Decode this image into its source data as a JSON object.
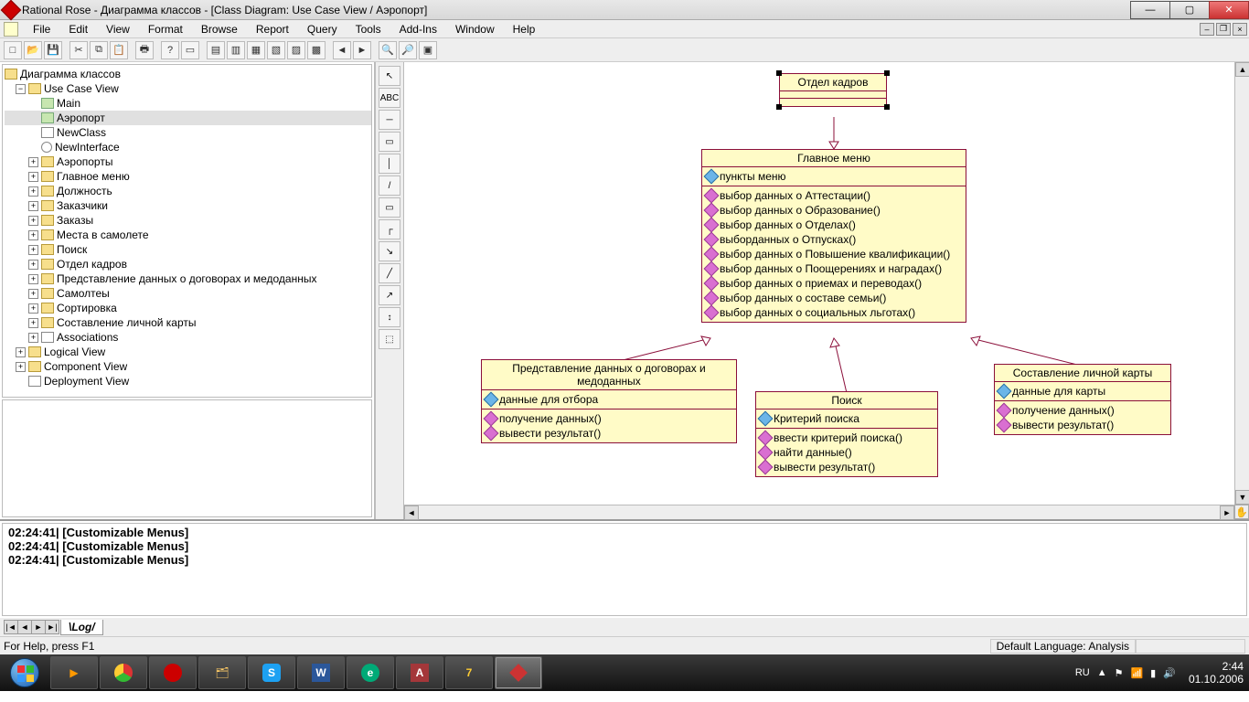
{
  "window": {
    "title": "Rational Rose - Диаграмма классов - [Class Diagram: Use Case View / Аэропорт]"
  },
  "menu": [
    "File",
    "Edit",
    "View",
    "Format",
    "Browse",
    "Report",
    "Query",
    "Tools",
    "Add-Ins",
    "Window",
    "Help"
  ],
  "tree": {
    "root": "Диаграмма классов",
    "usecase": "Use Case View",
    "main": "Main",
    "airport": "Аэропорт",
    "newclass": "NewClass",
    "newinterface": "NewInterface",
    "pkgs": [
      "Аэропорты",
      "Главное меню",
      "Должность",
      "Заказчики",
      "Заказы",
      "Места в самолете",
      "Поиск",
      "Отдел кадров",
      "Представление данных о договорах и медоданных",
      "Самолтеы",
      "Сортировка",
      "Составление личной карты",
      "Associations"
    ],
    "logical": "Logical View",
    "component": "Component View",
    "deployment": "Deployment View"
  },
  "toolbox_labels": [
    "↖",
    "ABC",
    "─",
    "▭",
    "│",
    "/",
    "▭",
    "┌",
    "↘",
    "╱",
    "↗",
    "↕",
    "⬚"
  ],
  "classes": {
    "hr": {
      "name": "Отдел кадров"
    },
    "menu": {
      "name": "Главное меню",
      "attrs": [
        "пункты меню"
      ],
      "ops": [
        "выбор данных о Аттестации()",
        "выбор данных о Образование()",
        "выбор данных о Отделах()",
        "выборданных о Отпусках()",
        "выбор данных о Повышение квалификации()",
        "выбор данных о Поощерениях и наградах()",
        "выбор данных о приемах и переводах()",
        "выбор данных о составе семьи()",
        "выбор данных о социальных льготах()"
      ]
    },
    "pres": {
      "name": "Представление данных о договорах и медоданных",
      "attrs": [
        "данные для отбора"
      ],
      "ops": [
        "получение данных()",
        "вывести результат()"
      ]
    },
    "search": {
      "name": "Поиск",
      "attrs": [
        "Критерий поиска"
      ],
      "ops": [
        "ввести критерий поиска()",
        "найти данные()",
        "вывести результат()"
      ]
    },
    "card": {
      "name": "Составление личной карты",
      "attrs": [
        "данные для карты"
      ],
      "ops": [
        "получение данных()",
        "вывести результат()"
      ]
    }
  },
  "log": {
    "lines": [
      "02:24:41|  [Customizable Menus]",
      "02:24:41|  [Customizable Menus]",
      "02:24:41|  [Customizable Menus]"
    ],
    "tab": "Log"
  },
  "status": {
    "help": "For Help, press F1",
    "lang": "Default Language: Analysis"
  },
  "taskbar": {
    "lang": "RU",
    "time": "2:44",
    "date": "01.10.2006"
  }
}
